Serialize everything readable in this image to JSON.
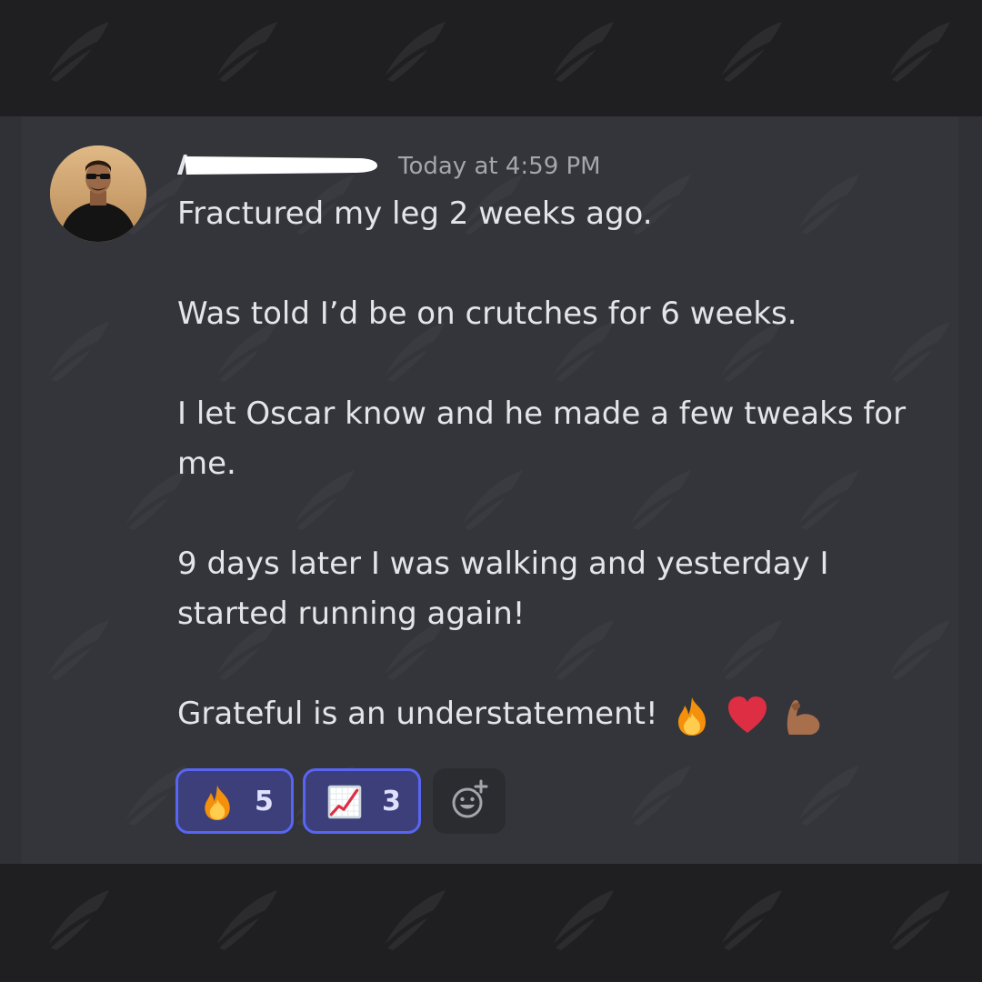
{
  "message": {
    "timestamp": "Today at 4:59 PM",
    "paragraphs": [
      "Fractured my leg 2 weeks ago.",
      "Was told I’d be on crutches for 6 weeks.",
      "I let Oscar know and he made a few tweaks for me.",
      "9 days later I was walking and yesterday I started running again!",
      "Grateful is an understatement!"
    ],
    "trailing_emojis": [
      "fire-emoji",
      "red-heart-emoji",
      "flexed-biceps-emoji"
    ]
  },
  "reactions": [
    {
      "emoji": "fire-emoji",
      "count": "5",
      "active": true
    },
    {
      "emoji": "chart-increasing-emoji",
      "count": "3",
      "active": true
    }
  ],
  "add_reaction_icon": "add-reaction-smiley-icon",
  "colors": {
    "background": "#1f1f21",
    "card": "#303136",
    "text": "#e3e5e8",
    "timestamp": "#a3a6ab",
    "reaction_border": "#5865f2",
    "reaction_bg": "#3c3f7a",
    "reaction_count": "#dee0fc"
  }
}
